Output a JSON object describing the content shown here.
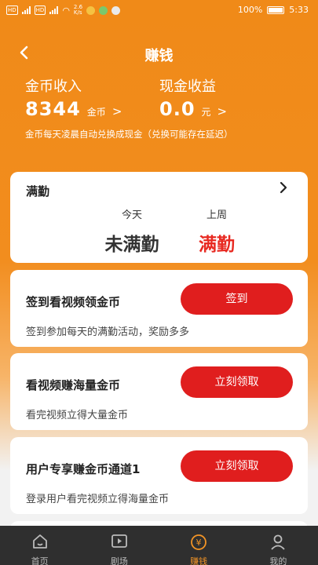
{
  "status_bar": {
    "hd1": "HD",
    "sig1": "4G",
    "hd2": "HD",
    "speed": "2.6\nK/s",
    "battery_pct": "100%",
    "time": "5:33"
  },
  "header": {
    "title": "赚钱",
    "back_icon": "chevron-left-icon"
  },
  "earnings": {
    "coin_label": "金币收入",
    "coin_value": "8344",
    "coin_unit": "金币",
    "cash_label": "现金收益",
    "cash_value": "0.0",
    "cash_unit": "元",
    "chevron": ">",
    "notice": "金币每天凌晨自动兑换成现金（兑换可能存在延迟）"
  },
  "attendance": {
    "title": "满勤",
    "chevron": ">",
    "today_label": "今天",
    "today_value": "未满勤",
    "last_week_label": "上周",
    "last_week_value": "满勤"
  },
  "tasks": [
    {
      "title": "签到看视频领金币",
      "desc": "签到参加每天的满勤活动，奖励多多",
      "button": "签到"
    },
    {
      "title": "看视频赚海量金币",
      "desc": "看完视频立得大量金币",
      "button": "立刻领取"
    },
    {
      "title": "用户专享赚金币通道1",
      "desc": "登录用户看完视频立得海量金币",
      "button": "立刻领取"
    }
  ],
  "bottom_nav": [
    {
      "label": "首页",
      "icon": "home-icon"
    },
    {
      "label": "剧场",
      "icon": "play-icon"
    },
    {
      "label": "赚钱",
      "icon": "yen-coin-icon"
    },
    {
      "label": "我的",
      "icon": "user-icon"
    }
  ],
  "colors": {
    "accent_orange": "#f08a18",
    "button_red": "#e01e1e",
    "highlight_red": "#e82a22",
    "nav_bg": "#2f2f2f",
    "nav_active": "#f29426"
  }
}
